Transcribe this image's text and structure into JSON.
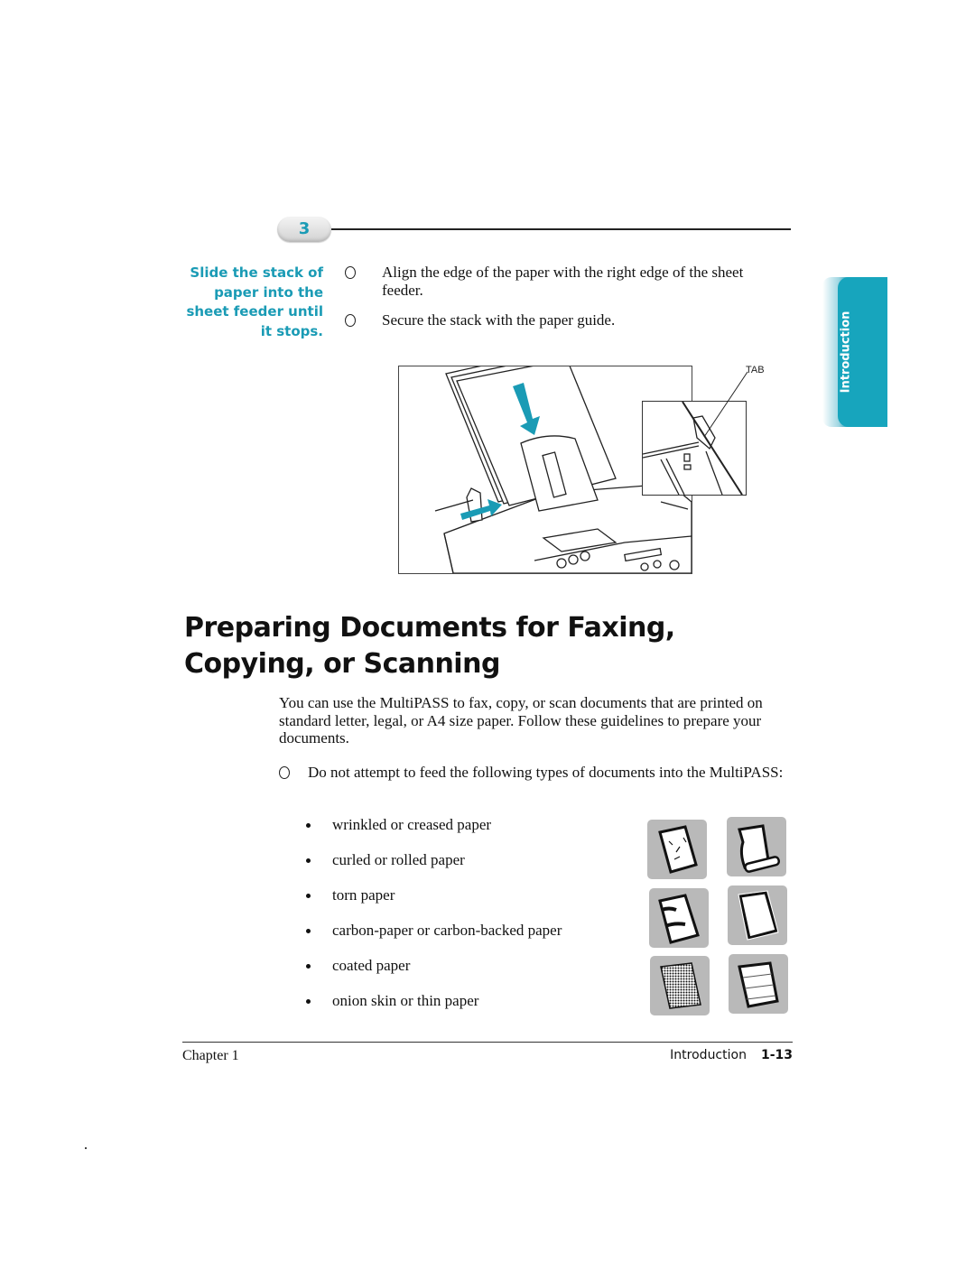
{
  "step": {
    "number": "3",
    "side_note": "Slide the stack of paper into the sheet feeder until it stops.",
    "instructions": [
      "Align the edge of the paper with the right edge of the sheet feeder.",
      "Secure the stack with the paper guide."
    ]
  },
  "figure": {
    "callout_label": "TAB",
    "accent_color": "#1a9bb5"
  },
  "chapter_tab": {
    "label": "Introduction",
    "color": "#17a5bd"
  },
  "section": {
    "title": "Preparing Documents for Faxing, Copying, or Scanning",
    "intro": "You can use the MultiPASS to fax, copy, or scan documents that are printed on standard letter, legal, or A4 size paper. Follow these guidelines to prepare your documents.",
    "warning": "Do not attempt to feed the following types of documents into the MultiPASS:",
    "bad_documents": [
      "wrinkled or creased paper",
      "curled or rolled paper",
      "torn paper",
      "carbon-paper or carbon-backed paper",
      "coated paper",
      "onion skin or thin paper"
    ],
    "icons": [
      "wrinkled-paper-icon",
      "curled-paper-icon",
      "torn-paper-icon",
      "carbon-paper-icon",
      "coated-paper-icon",
      "thin-paper-icon"
    ]
  },
  "footer": {
    "chapter": "Chapter 1",
    "section": "Introduction",
    "page": "1-13"
  }
}
